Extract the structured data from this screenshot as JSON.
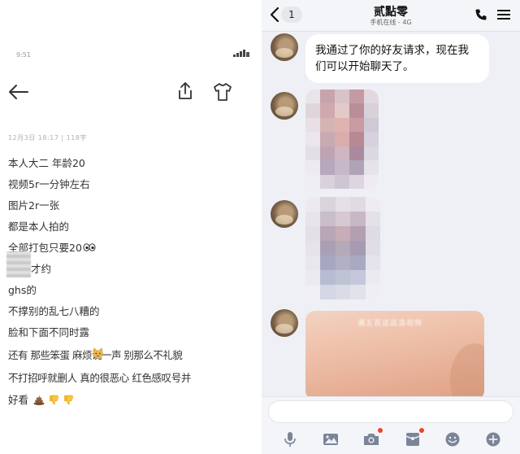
{
  "left": {
    "status_time": "9:51",
    "meta": "12月3日 18:17 | 118字",
    "lines": [
      "本人大二 年龄20",
      "视频5r一分钟左右",
      "图片2r一张",
      "都是本人拍的",
      "全部打包只要20",
      "才约",
      "ghs的",
      "不撑别的乱七八糟的",
      "脸和下面不同时露",
      "还有 那些笨蛋 麻烦说一声 别那么不礼貌",
      "不打招呼就删人 真的很恶心 红色感叹号并",
      "好看"
    ]
  },
  "chat": {
    "back_badge": "1",
    "title": "贰點零",
    "subtitle": "手机在线 - 4G",
    "message": "我通过了你的好友请求，现在我们可以开始聊天了。",
    "photo_caption": "满五百送高清视频",
    "input_placeholder": ""
  },
  "icons": {
    "back": "back-arrow-icon",
    "share": "share-icon",
    "tshirt": "tshirt-icon",
    "phone": "phone-icon",
    "menu": "menu-icon",
    "mic": "microphone-icon",
    "image": "image-icon",
    "camera": "camera-icon",
    "redpacket": "red-packet-icon",
    "emoji": "emoji-icon",
    "plus": "plus-icon"
  },
  "colors": {
    "chat_bg": "#eef0f6",
    "bubble": "#ffffff",
    "badge_dot": "#f0412f",
    "tool_icon": "#7b8598"
  }
}
